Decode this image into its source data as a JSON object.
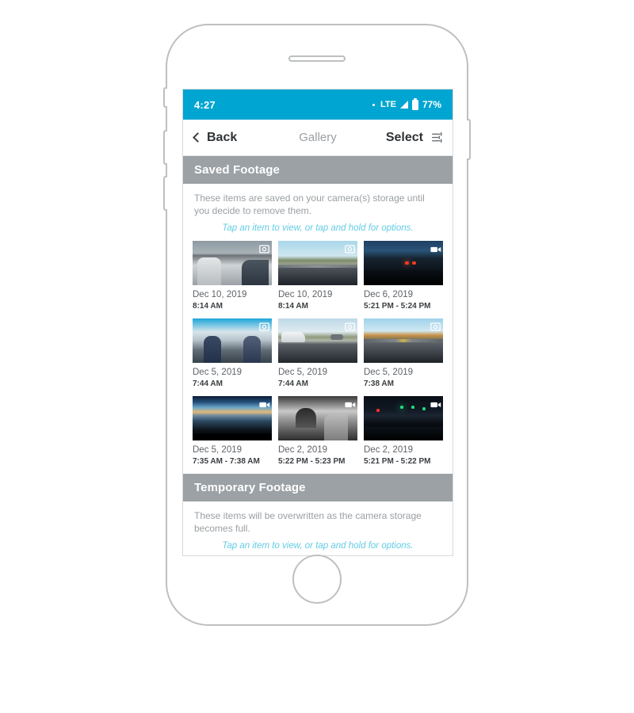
{
  "status_bar": {
    "time": "4:27",
    "network": "LTE",
    "battery": "77%",
    "dot_icon": "dot-indicator-icon",
    "signal_icon": "signal-strength-icon",
    "battery_icon": "battery-icon",
    "background_color": "#00a5d1"
  },
  "nav_bar": {
    "back_label": "Back",
    "back_icon": "chevron-left-icon",
    "title": "Gallery",
    "select_label": "Select",
    "filter_icon": "sliders-filter-icon"
  },
  "sections": [
    {
      "title": "Saved Footage",
      "description": "These items are saved on your camera(s) storage until you decide to remove them.",
      "hint": "Tap an item to view, or tap and hold for options.",
      "rows": [
        [
          {
            "date": "Dec 10, 2019",
            "time": "8:14 AM",
            "badge": "photo-badge-icon",
            "scene": "sc-cabin-day"
          },
          {
            "date": "Dec 10, 2019",
            "time": "8:14 AM",
            "badge": "photo-badge-icon",
            "scene": "sc-road-day"
          },
          {
            "date": "Dec 6, 2019",
            "time": "5:21 PM - 5:24 PM",
            "badge": "video-badge-icon",
            "scene": "sc-night-road"
          }
        ],
        [
          {
            "date": "Dec 5, 2019",
            "time": "7:44 AM",
            "badge": "photo-badge-icon",
            "scene": "sc-cabin-blue"
          },
          {
            "date": "Dec 5, 2019",
            "time": "7:44 AM",
            "badge": "photo-badge-icon",
            "scene": "sc-road-car"
          },
          {
            "date": "Dec 5, 2019",
            "time": "7:38 AM",
            "badge": "photo-badge-icon",
            "scene": "sc-road-fall"
          }
        ],
        [
          {
            "date": "Dec 5, 2019",
            "time": "7:35 AM - 7:38 AM",
            "badge": "video-badge-icon",
            "scene": "sc-dawn"
          },
          {
            "date": "Dec 2, 2019",
            "time": "5:22 PM - 5:23 PM",
            "badge": "video-badge-icon",
            "scene": "sc-ir"
          },
          {
            "date": "Dec 2, 2019",
            "time": "5:21 PM - 5:22 PM",
            "badge": "video-badge-icon",
            "scene": "sc-night-int"
          }
        ]
      ]
    },
    {
      "title": "Temporary Footage",
      "description": "These items will be overwritten as the camera storage becomes full.",
      "hint": "Tap an item to view, or tap and hold for options.",
      "partial_thumbs": [
        {
          "scene": "sc-temp-dark"
        },
        {
          "scene": "sc-temp-blue"
        },
        {
          "scene": "sc-temp-dark2"
        }
      ]
    }
  ],
  "colors": {
    "accent": "#00a5d1",
    "section_header_bg": "#9ba1a5",
    "hint_text": "#63cbe4",
    "body_text": "#9a9fa3",
    "frame_outline": "#bdbfc1"
  }
}
